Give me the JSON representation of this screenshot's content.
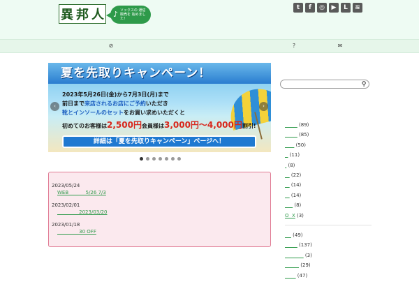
{
  "header": {
    "logo_chars": [
      "異",
      "邦",
      "人"
    ],
    "bubble_text": "ソックスの 通信販売を 始めました！",
    "social_icons": [
      "twitter-icon",
      "facebook-icon",
      "instagram-icon",
      "youtube-icon",
      "line-icon",
      "rss-icon"
    ],
    "social_glyphs": [
      "t",
      "f",
      "◎",
      "▶",
      "L",
      "≋"
    ]
  },
  "nav": {
    "icons": [
      "check-circle-icon",
      "help-circle-icon",
      "mail-icon"
    ],
    "glyphs": [
      "⊘",
      "?",
      "✉"
    ]
  },
  "banner": {
    "title": "夏を先取りキャンペーン！",
    "line1": "2023年5月26日(金)から7月3日(月)まで",
    "line2a": "前日まで",
    "line2b": "来店されるお店にご予約",
    "line2c": "いただき",
    "line3a": "靴とインソールのセット",
    "line3b": "をお買い求めいただくと",
    "price_prefix": "初めてのお客様は",
    "price_first": "2,500円",
    "price_mid": "会員様は",
    "price_member": "3,000円～4,000円",
    "price_suffix": "割引!",
    "cta": "詳細は「夏を先取りキャンペーン」ページへ！",
    "prev": "‹",
    "next": "›",
    "slide_count": 7,
    "active_slide": 1
  },
  "news": [
    {
      "date": "2023/05/24",
      "link": "WEB           5/26 7/3"
    },
    {
      "date": "2023/02/01",
      "link": "              2023/03/20"
    },
    {
      "date": "2023/01/18",
      "link": "              30 OFF"
    }
  ],
  "search": {
    "placeholder": "",
    "icon": "search-icon"
  },
  "categories": [
    {
      "link": "        ",
      "count": "(89)"
    },
    {
      "link": "        ",
      "count": "(85)"
    },
    {
      "link": "      ",
      "count": "(50)"
    },
    {
      "link": "  ",
      "count": "(11)"
    },
    {
      "link": " ",
      "count": "(8)"
    },
    {
      "link": "   ",
      "count": "(22)"
    },
    {
      "link": "   ",
      "count": "(14)"
    },
    {
      "link": "   ",
      "count": "(14)"
    },
    {
      "link": "     ",
      "count": "(8)"
    },
    {
      "link": "O  X",
      "count": "(3)"
    }
  ],
  "categories2": [
    {
      "link": "    ",
      "count": "(49)"
    },
    {
      "link": "        ",
      "count": "(137)"
    },
    {
      "link": "            ",
      "count": "(3)"
    },
    {
      "link": "         ",
      "count": "(29)"
    },
    {
      "link": "       ",
      "count": "(47)"
    }
  ]
}
